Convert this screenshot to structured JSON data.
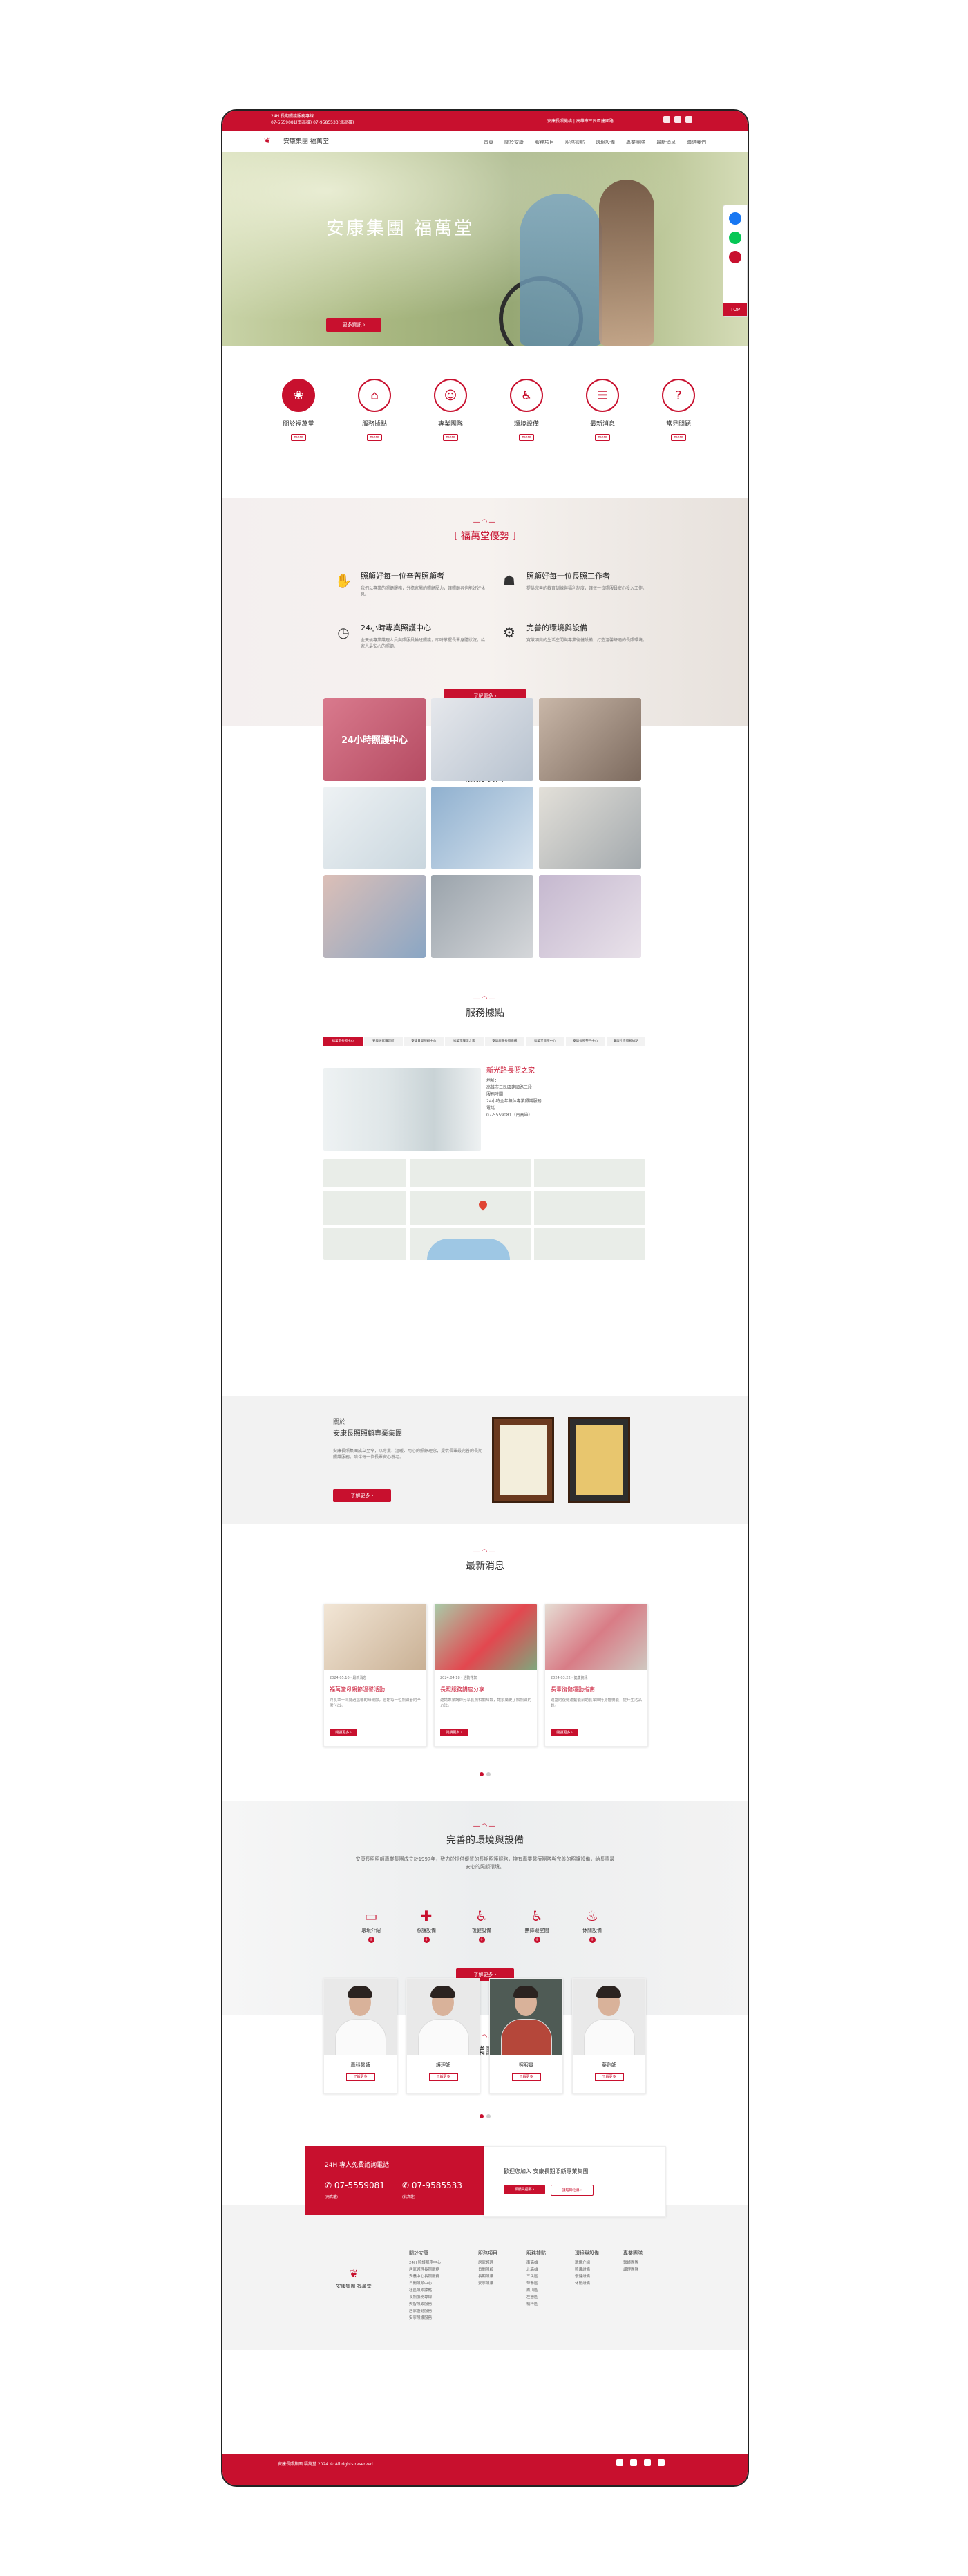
{
  "topbar": {
    "line1": "24H 長期照護服務專線",
    "line2": "07-5559081(南高雄) 07-9585533(北高雄)",
    "right": "安康長照機構 | 高雄市三民區建國路"
  },
  "brand": {
    "logo_text": "安康集團 福萬堂"
  },
  "nav": [
    "首頁",
    "關於安康",
    "服務項目",
    "服務據點",
    "環境設備",
    "專業團隊",
    "最新消息",
    "聯絡我們"
  ],
  "hero": {
    "title": "安康集團 福萬堂",
    "button": "更多資訊 ›"
  },
  "side": {
    "top": "TOP"
  },
  "quick": [
    {
      "label": "關於福萬堂",
      "more": "more"
    },
    {
      "label": "服務據點",
      "more": "more"
    },
    {
      "label": "專業團隊",
      "more": "more"
    },
    {
      "label": "環境設備",
      "more": "more"
    },
    {
      "label": "最新消息",
      "more": "more"
    },
    {
      "label": "常見問題",
      "more": "more"
    }
  ],
  "advantages": {
    "title": "[ 福萬堂優勢 ]",
    "items": [
      {
        "h": "照顧好每一位辛苦照顧者",
        "d": "我們以專業的照顧服務，分擔家屬的照顧壓力，讓照顧者也能好好休息。"
      },
      {
        "h": "照顧好每一位長照工作者",
        "d": "提供完善的教育訓練與福利制度，讓每一位照服員安心投入工作。"
      },
      {
        "h": "24小時專業照護中心",
        "d": "全天候專業護理人員與照服員輪班照護，即時掌握長輩身體狀況，給家人最安心的照顧。"
      },
      {
        "h": "完善的環境與設備",
        "d": "寬敞明亮的生活空間與專業復健設備，打造溫馨舒適的長照環境。"
      }
    ],
    "button": "了解更多 ›"
  },
  "services": {
    "title": "服務項目",
    "items": [
      {
        "caption": "24小時照護中心"
      },
      {
        "caption": ""
      },
      {
        "caption": ""
      },
      {
        "caption": ""
      },
      {
        "caption": ""
      },
      {
        "caption": ""
      },
      {
        "caption": ""
      },
      {
        "caption": ""
      },
      {
        "caption": ""
      }
    ]
  },
  "locations": {
    "title": "服務據點",
    "tabs": [
      "福萬堂長照中心",
      "安康居家護理所",
      "安康日間照顧中心",
      "福萬堂護理之家",
      "安康居家長照機構",
      "福萬堂日照中心",
      "安康長照整合中心",
      "安康社區照顧據點"
    ],
    "name": "新光路長照之家",
    "rows": [
      "地址：",
      "高雄市三民區建國路二段",
      "服務時間：",
      "24小時全年無休專業照護服務",
      "電話：",
      "07-5559081（南高雄）"
    ]
  },
  "about": {
    "pre": "關於",
    "title": "安康長照照顧專業集團",
    "desc": "安康長照集團成立至今，以專業、溫暖、用心的照顧理念，提供長輩最完善的長期照護服務，陪伴每一位長輩安心養老。",
    "button": "了解更多 ›"
  },
  "news": {
    "title": "最新消息",
    "items": [
      {
        "date": "2024.05.10",
        "tag": "最新消息",
        "title": "福萬堂母親節溫馨活動",
        "desc": "與長輩一同度過溫馨的母親節，感謝每一位照顧者的辛勞付出。",
        "more": "閱讀更多 ›"
      },
      {
        "date": "2024.04.18",
        "tag": "活動花絮",
        "title": "長照服務講座分享",
        "desc": "邀請專業講師分享長照相關知識，讓家屬更了解照顧的方法。",
        "more": "閱讀更多 ›"
      },
      {
        "date": "2024.03.22",
        "tag": "健康資訊",
        "title": "長輩復健運動指南",
        "desc": "適當的復健運動能幫助長輩維持身體機能，提升生活品質。",
        "more": "閱讀更多 ›"
      }
    ]
  },
  "environment": {
    "title": "完善的環境與設備",
    "desc": "安康長照照顧專業集團成立於1997年，致力於提供優質的長期照護服務，擁有專業醫療團隊與完善的照護設備，給長輩最安心的照顧環境。",
    "items": [
      {
        "label": "環境介紹"
      },
      {
        "label": "照護設備"
      },
      {
        "label": "復健設備"
      },
      {
        "label": "無障礙空間"
      },
      {
        "label": "休閒設備"
      }
    ],
    "button": "了解更多 ›"
  },
  "team": {
    "title": "專業團隊",
    "members": [
      {
        "name": "專科醫師",
        "more": "了解更多"
      },
      {
        "name": "護理師",
        "more": "了解更多"
      },
      {
        "name": "照服員",
        "more": "了解更多"
      },
      {
        "name": "藥劑師",
        "more": "了解更多"
      }
    ]
  },
  "cta": {
    "left_title": "24H 專人免費諮詢電話",
    "phone1": "07-5559081",
    "phone1_note": "(南高雄)",
    "phone2": "07-9585533",
    "phone2_note": "(北高雄)",
    "right_title": "歡迎您加入 安康長期照顧專業集團",
    "btn1": "照服員招募 ›",
    "btn2": "護理師招募 ›"
  },
  "footer": {
    "logo_text": "安康集團 福萬堂",
    "cols": [
      {
        "h": "關於安康",
        "items": [
          "24H 照護服務中心",
          "居家護理長照服務",
          "安養中心長照服務",
          "日間照顧中心",
          "社區照顧據點",
          "長照服務專線",
          "失智照顧服務",
          "居家復健服務",
          "安寧照護服務"
        ]
      },
      {
        "h": "服務項目",
        "items": [
          "居家護理",
          "日間照顧",
          "長期照護",
          "安寧照護"
        ]
      },
      {
        "h": "服務據點",
        "items": [
          "南高雄",
          "北高雄",
          "三民區",
          "苓雅區",
          "鳳山區",
          "左營區",
          "楠梓區"
        ]
      },
      {
        "h": "環境與設備",
        "items": [
          "環境介紹",
          "照護設備",
          "復健設備",
          "休閒設備"
        ]
      },
      {
        "h": "專業團隊",
        "items": [
          "醫師團隊",
          "護理團隊"
        ]
      }
    ]
  },
  "copyright": "安康長照集團 福萬堂 2024 © All rights reserved.",
  "colors": {
    "brand": "#c8102e"
  }
}
